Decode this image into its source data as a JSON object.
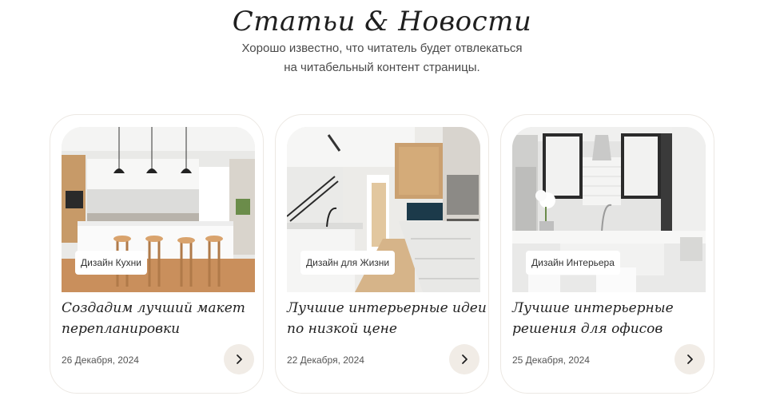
{
  "section": {
    "title": "Статьи & Новости",
    "subtitle_line1": "Хорошо известно, что читатель будет отвлекаться",
    "subtitle_line2": "на читабельный контент страницы."
  },
  "cards": [
    {
      "tag": "Дизайн Кухни",
      "title_line1": "Создадим лучший макет",
      "title_line2": "перепланировки",
      "date": "26 Декабря, 2024",
      "icon": "chevron-right-icon"
    },
    {
      "tag": "Дизайн для Жизни",
      "title_line1": "Лучшие интерьерные идеи",
      "title_line2": "по низкой цене",
      "date": "22 Декабря, 2024",
      "icon": "chevron-right-icon"
    },
    {
      "tag": "Дизайн Интерьера",
      "title_line1": "Лучшие интерьерные",
      "title_line2": "решения для офисов",
      "date": "25 Декабря, 2024",
      "icon": "chevron-right-icon"
    }
  ],
  "colors": {
    "button_bg": "#f1ece6",
    "card_border": "#ece8e3",
    "text": "#1f1f1f"
  }
}
